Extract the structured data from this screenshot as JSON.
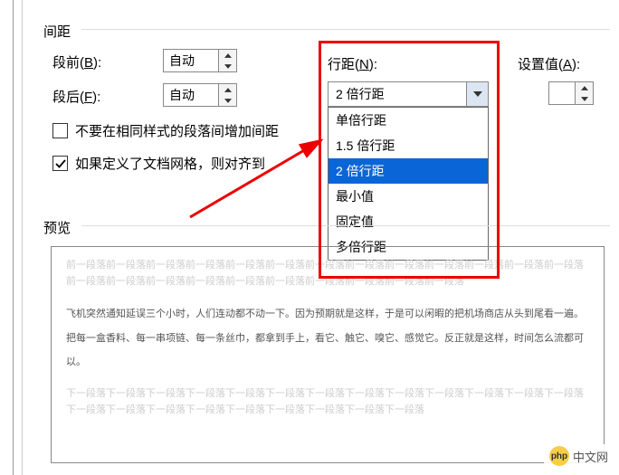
{
  "section": {
    "title": "间距"
  },
  "spacing": {
    "before_label": "段前(",
    "before_key": "B",
    "before_label_tail": "):",
    "before_value": "自动",
    "after_label": "段后(",
    "after_key": "F",
    "after_label_tail": "):",
    "after_value": "自动"
  },
  "line_spacing": {
    "label": "行距(",
    "key": "N",
    "label_tail": "):",
    "selected": "2 倍行距",
    "options": [
      "单倍行距",
      "1.5 倍行距",
      "2 倍行距",
      "最小值",
      "固定值",
      "多倍行距"
    ]
  },
  "set_value": {
    "label": "设置值(",
    "key": "A",
    "label_tail": "):",
    "value": ""
  },
  "checkbox1": {
    "checked": false,
    "label": "不要在相同样式的段落间增加间距"
  },
  "checkbox2": {
    "checked": true,
    "label": "如果定义了文档网格，则对齐到"
  },
  "preview": {
    "label": "预览",
    "faint_before": "前一段落前一段落前一段落前一段落前一段落前一段落前一段落前一段落前一段落前一段落前一段落前一段落前一段落前一段落前一段落前一段落前一段落前一段落前一段落前一段落前一段落前一段落前一段落",
    "body": "飞机突然通知延误三个小时，人们连动都不动一下。因为预期就是这样，于是可以闲暇的把机场商店从头到尾看一遍。把每一盒香料、每一串项链、每一条丝巾，都拿到手上，看它、触它、嗅它、感觉它。反正就是这样，时间怎么流都可以。",
    "faint_after": "下一段落下一段落下一段落下一段落下一段落下一段落下一段落下一段落下一段落下一段落下一段落下一段落下一段落下一段落下一段落下一段落下一段落下一段落下一段落下一段落下一段落下一段落"
  },
  "watermark": {
    "logo": "php",
    "text": "中文网"
  }
}
